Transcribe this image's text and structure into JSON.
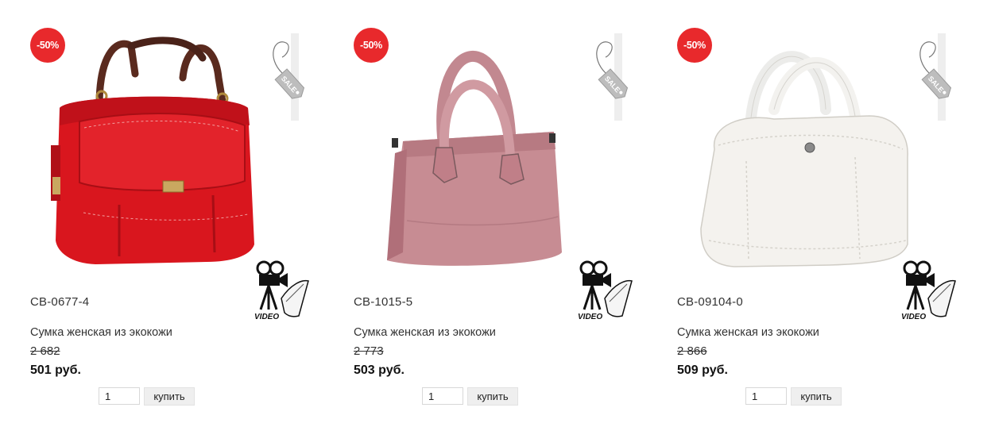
{
  "products": [
    {
      "discount": "-50%",
      "sku": "СВ-0677-4",
      "name": "Сумка женская из экокожи",
      "old_price": "2 682",
      "price": "501 руб.",
      "quantity": "1",
      "buy_label": "купить",
      "sale_label": "SALE",
      "video_label": "VIDEO",
      "bag_color": "#d9161e",
      "icon": "handbag-icon"
    },
    {
      "discount": "-50%",
      "sku": "СВ-1015-5",
      "name": "Сумка женская из экокожи",
      "old_price": "2 773",
      "price": "503 руб.",
      "quantity": "1",
      "buy_label": "купить",
      "sale_label": "SALE",
      "video_label": "VIDEO",
      "bag_color": "#c78c93",
      "icon": "handbag-icon"
    },
    {
      "discount": "-50%",
      "sku": "СВ-09104-0",
      "name": "Сумка женская из экокожи",
      "old_price": "2 866",
      "price": "509 руб.",
      "quantity": "1",
      "buy_label": "купить",
      "sale_label": "SALE",
      "video_label": "VIDEO",
      "bag_color": "#f4f2ee",
      "icon": "handbag-icon"
    }
  ],
  "colors": {
    "badge": "#e8292c",
    "button_bg": "#efefef"
  }
}
